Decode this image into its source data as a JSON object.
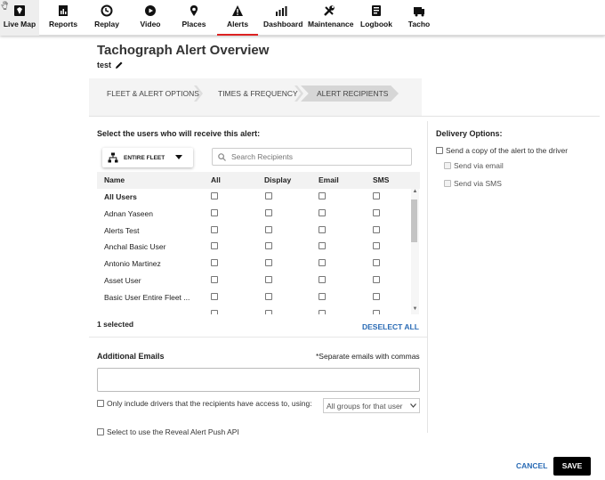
{
  "nav": {
    "items": [
      {
        "label": "Live Map",
        "icon": "live-map-icon"
      },
      {
        "label": "Reports",
        "icon": "reports-icon"
      },
      {
        "label": "Replay",
        "icon": "replay-icon"
      },
      {
        "label": "Video",
        "icon": "video-icon"
      },
      {
        "label": "Places",
        "icon": "places-icon"
      },
      {
        "label": "Alerts",
        "icon": "alerts-icon"
      },
      {
        "label": "Dashboard",
        "icon": "dashboard-icon"
      },
      {
        "label": "Maintenance",
        "icon": "maintenance-icon"
      },
      {
        "label": "Logbook",
        "icon": "logbook-icon"
      },
      {
        "label": "Tacho",
        "icon": "tacho-icon"
      }
    ],
    "active": "Alerts",
    "accent": "#dd2222"
  },
  "page": {
    "title": "Tachograph Alert Overview",
    "alert_name": "test"
  },
  "steps": [
    "FLEET & ALERT OPTIONS",
    "TIMES & FREQUENCY",
    "ALERT RECIPIENTS"
  ],
  "recipients": {
    "heading": "Select the users who will receive this alert:",
    "fleet_label": "ENTIRE FLEET",
    "search_placeholder": "Search Recipients",
    "columns": [
      "Name",
      "All",
      "Display",
      "Email",
      "SMS"
    ],
    "rows": [
      "All Users",
      "Adnan Yaseen",
      "Alerts Test",
      "Anchal Basic User",
      "Antonio Martinez",
      "Asset User",
      "Basic User Entire Fleet ..."
    ],
    "selected_count": "1 selected",
    "deselect_all": "DESELECT ALL"
  },
  "delivery": {
    "heading": "Delivery Options:",
    "send_copy": "Send a copy of the alert to the driver",
    "via_email": "Send via email",
    "via_sms": "Send via SMS"
  },
  "additional": {
    "heading": "Additional Emails",
    "note": "*Separate emails with commas",
    "email_value": "",
    "only_include": "Only include drivers that the recipients have access to, using:",
    "groups_value": "All groups for that user",
    "reveal_api": "Select to use the Reveal Alert Push API"
  },
  "footer": {
    "cancel": "CANCEL",
    "save": "SAVE"
  },
  "colors": {
    "link": "#2a6bb5"
  }
}
